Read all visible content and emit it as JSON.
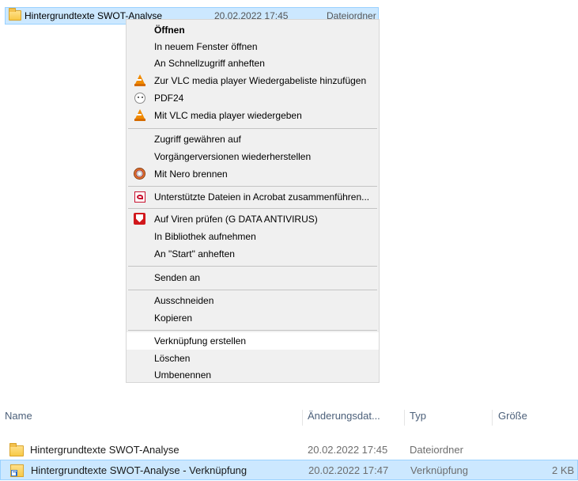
{
  "top_row": {
    "name": "Hintergrundtexte SWOT-Analyse",
    "date": "20.02.2022 17:45",
    "type": "Dateiordner"
  },
  "context_menu": {
    "items": [
      {
        "label": "Öffnen",
        "icon": ""
      },
      {
        "label": "In neuem Fenster öffnen",
        "icon": ""
      },
      {
        "label": "An Schnellzugriff anheften",
        "icon": ""
      },
      {
        "label": "Zur VLC media player Wiedergabeliste hinzufügen",
        "icon": "vlc-icon"
      },
      {
        "label": "PDF24",
        "icon": "pdf24-icon"
      },
      {
        "label": "Mit VLC media player wiedergeben",
        "icon": "vlc-icon"
      },
      {
        "label": "Zugriff gewähren auf",
        "icon": ""
      },
      {
        "label": "Vorgängerversionen wiederherstellen",
        "icon": ""
      },
      {
        "label": "Mit Nero brennen",
        "icon": "nero-icon"
      },
      {
        "label": "Unterstützte Dateien in Acrobat zusammenführen...",
        "icon": "acrobat-icon"
      },
      {
        "label": "Auf Viren prüfen (G DATA ANTIVIRUS)",
        "icon": "gdata-shield-icon"
      },
      {
        "label": "In Bibliothek aufnehmen",
        "icon": ""
      },
      {
        "label": "An \"Start\" anheften",
        "icon": ""
      },
      {
        "label": "Senden an",
        "icon": ""
      },
      {
        "label": "Ausschneiden",
        "icon": ""
      },
      {
        "label": "Kopieren",
        "icon": ""
      },
      {
        "label": "Verknüpfung erstellen",
        "icon": ""
      },
      {
        "label": "Löschen",
        "icon": ""
      },
      {
        "label": "Umbenennen",
        "icon": ""
      }
    ]
  },
  "file_list": {
    "columns": [
      "Name",
      "Änderungsdat...",
      "Typ",
      "Größe"
    ],
    "rows": [
      {
        "name": "Hintergrundtexte SWOT-Analyse",
        "date": "20.02.2022 17:45",
        "type": "Dateiordner",
        "size": "",
        "icon": "folder-icon"
      },
      {
        "name": "Hintergrundtexte SWOT-Analyse - Verknüpfung",
        "date": "20.02.2022 17:47",
        "type": "Verknüpfung",
        "size": "2 KB",
        "icon": "shortcut-icon"
      }
    ]
  },
  "colors": {
    "selection_bg": "#cce8ff",
    "selection_border": "#99d1ff",
    "menu_bg": "#f0f0f0",
    "header_text": "#4c607a"
  }
}
